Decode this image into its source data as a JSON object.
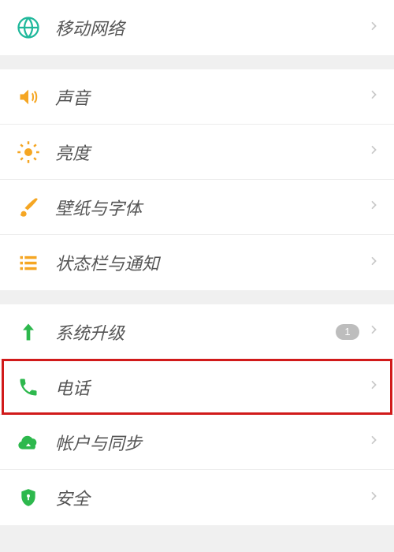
{
  "colors": {
    "teal": "#1fb89b",
    "orange": "#f5a623",
    "green": "#2db84d",
    "badge_bg": "#bdbdbd",
    "highlight": "#d11a1a"
  },
  "groups": [
    {
      "items": [
        {
          "key": "mobile-network",
          "icon": "globe",
          "label": "移动网络"
        }
      ]
    },
    {
      "items": [
        {
          "key": "sound",
          "icon": "speaker",
          "label": "声音"
        },
        {
          "key": "brightness",
          "icon": "sun",
          "label": "亮度"
        },
        {
          "key": "wallpaper-font",
          "icon": "brush",
          "label": "壁纸与字体"
        },
        {
          "key": "statusbar-notification",
          "icon": "list",
          "label": "状态栏与通知"
        }
      ]
    },
    {
      "items": [
        {
          "key": "system-update",
          "icon": "arrow-up",
          "label": "系统升级",
          "badge": "1"
        },
        {
          "key": "phone",
          "icon": "phone",
          "label": "电话",
          "highlighted": true
        },
        {
          "key": "account-sync",
          "icon": "cloud",
          "label": "帐户与同步"
        },
        {
          "key": "security",
          "icon": "shield",
          "label": "安全"
        }
      ]
    }
  ]
}
